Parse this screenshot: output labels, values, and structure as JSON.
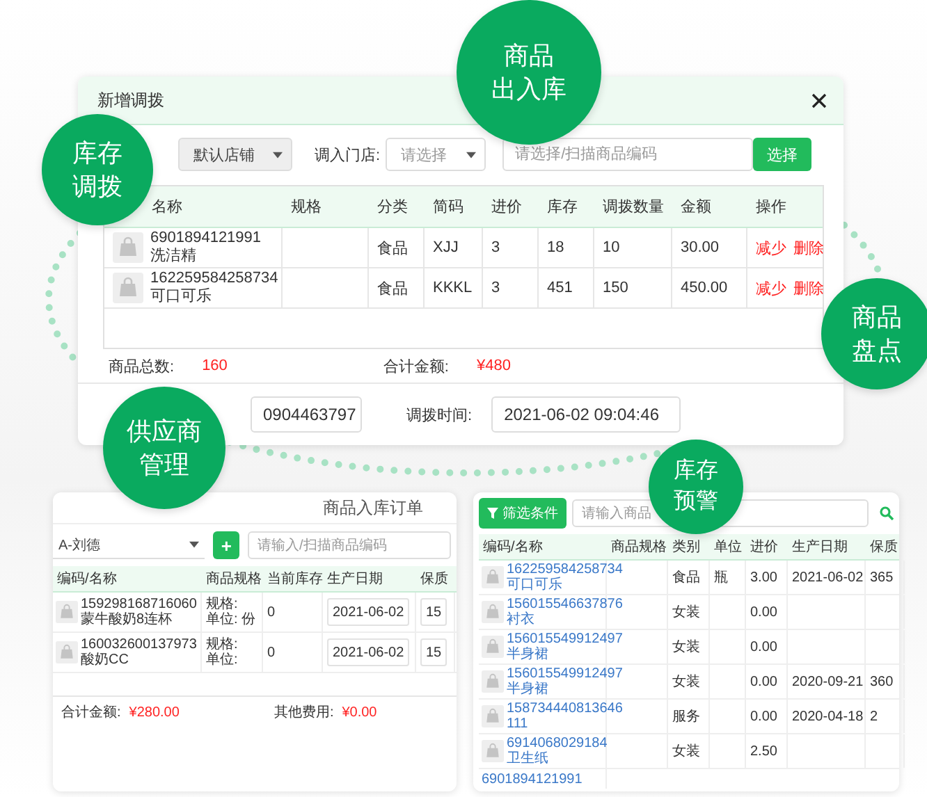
{
  "badges": [
    {
      "lines": [
        "商品",
        "出入库"
      ]
    },
    {
      "lines": [
        "库存",
        "调拨"
      ]
    },
    {
      "lines": [
        "商品",
        "盘点"
      ]
    },
    {
      "lines": [
        "供应商",
        "管理"
      ]
    },
    {
      "lines": [
        "库存",
        "预警"
      ]
    }
  ],
  "transfer_dialog": {
    "title": "新增调拨",
    "from_store": "默认店铺",
    "to_store_label": "调入门店:",
    "to_store_placeholder": "请选择",
    "search_placeholder": "请选择/扫描商品编码",
    "select_button": "选择",
    "columns": [
      "名称",
      "规格",
      "分类",
      "简码",
      "进价",
      "库存",
      "调拨数量",
      "金额",
      "操作"
    ],
    "rows": [
      {
        "code": "6901894121991",
        "name": "洗洁精",
        "category": "食品",
        "short_code": "XJJ",
        "cost": "3",
        "stock": "18",
        "quantity": "10",
        "amount": "30.00",
        "actions": [
          "减少",
          "删除"
        ]
      },
      {
        "code": "162259584258734",
        "name": "可口可乐",
        "category": "食品",
        "short_code": "KKKL",
        "cost": "3",
        "stock": "451",
        "quantity": "150",
        "amount": "450.00",
        "actions": [
          "减少",
          "删除"
        ]
      }
    ],
    "total_count_label": "商品总数:",
    "total_count": "160",
    "total_amount_label": "合计金额:",
    "total_amount": "¥480",
    "order_no": "0904463797",
    "time_label": "调拨时间:",
    "time_value": "2021-06-02 09:04:46"
  },
  "stock_in_order": {
    "title": "商品入库订单",
    "supplier": "A-刘德",
    "add_button": "+",
    "search_placeholder": "请输入/扫描商品编码",
    "columns": [
      "编码/名称",
      "商品规格",
      "当前库存",
      "生产日期",
      "保质"
    ],
    "rows": [
      {
        "code": "159298168716060",
        "name": "蒙牛酸奶8连杯",
        "spec": "规格:",
        "unit": "单位: 份",
        "stock": "0",
        "production_date": "2021-06-02",
        "shelf_life": "15"
      },
      {
        "code": "160032600137973",
        "name": "酸奶CC",
        "spec": "规格:",
        "unit": "单位:",
        "stock": "0",
        "production_date": "2021-06-02",
        "shelf_life": "15"
      }
    ],
    "total_label": "合计金额:",
    "total": "¥280.00",
    "other_label": "其他费用:",
    "other": "¥0.00"
  },
  "stock_warning": {
    "filter_button": "筛选条件",
    "search_placeholder": "请输入商品",
    "columns": [
      "编码/名称",
      "商品规格",
      "类别",
      "单位",
      "进价",
      "生产日期",
      "保质"
    ],
    "rows": [
      {
        "code": "162259584258734",
        "name": "可口可乐",
        "category": "食品",
        "unit": "瓶",
        "cost": "3.00",
        "production_date": "2021-06-02",
        "shelf_life": "365"
      },
      {
        "code": "156015546637876",
        "name": "衬衣",
        "category": "女装",
        "cost": "0.00"
      },
      {
        "code": "156015549912497",
        "name": "半身裙",
        "category": "女装",
        "cost": "0.00"
      },
      {
        "code": "156015549912497",
        "name": "半身裙",
        "category": "女装",
        "cost": "0.00",
        "production_date": "2020-09-21",
        "shelf_life": "360"
      },
      {
        "code": "158734440813646",
        "name": "111",
        "category": "服务",
        "cost": "0.00",
        "production_date": "2020-04-18",
        "shelf_life": "2"
      },
      {
        "code": "6914068029184",
        "name": "卫生纸",
        "category": "女装",
        "cost": "2.50"
      },
      {
        "code": "6901894121991"
      }
    ]
  }
}
